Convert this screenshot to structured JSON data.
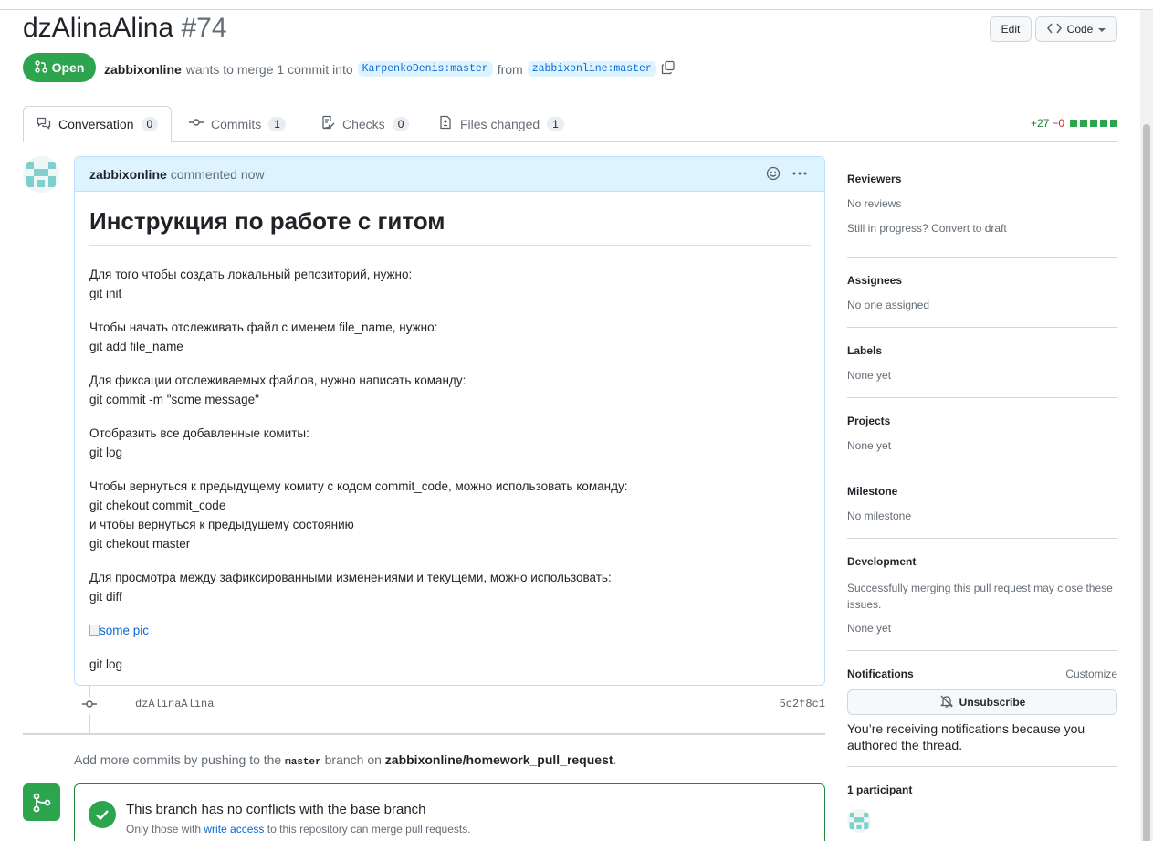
{
  "header": {
    "title": "dzAlinaAlina",
    "number": "#74",
    "edit_label": "Edit",
    "code_label": "Code"
  },
  "status": {
    "state_label": "Open",
    "author": "zabbixonline",
    "merge_text": "wants to merge 1 commit into",
    "base_branch": "KarpenkoDenis:master",
    "from_text": "from",
    "head_branch": "zabbixonline:master"
  },
  "tabs": [
    {
      "label": "Conversation",
      "count": "0",
      "icon": "comment-discussion-icon"
    },
    {
      "label": "Commits",
      "count": "1",
      "icon": "git-commit-icon"
    },
    {
      "label": "Checks",
      "count": "0",
      "icon": "checklist-icon"
    },
    {
      "label": "Files changed",
      "count": "1",
      "icon": "file-diff-icon"
    }
  ],
  "diffstat": {
    "additions": "+27",
    "deletions": "−0"
  },
  "comment": {
    "author": "zabbixonline",
    "action": "commented now",
    "heading": "Инструкция по работе с гитом",
    "paragraphs": [
      [
        "Для того чтобы создать локальный репозиторий, нужно:",
        "git init"
      ],
      [
        "Чтобы начать отслеживать файл с именем file_name, нужно:",
        "git add file_name"
      ],
      [
        "Для фиксации отслеживаемых файлов, нужно написать команду:",
        "git commit -m \"some message\""
      ],
      [
        "Отобразить все добавленные комиты:",
        "git log"
      ],
      [
        "Чтобы вернуться к предыдущему комиту с кодом commit_code, можно использовать команду:",
        "git chekout commit_code",
        "и чтобы вернуться к предыдущему состоянию",
        "git chekout master"
      ],
      [
        "Для просмотра между зафиксированными изменениями и текущеми, можно использовать:",
        "git diff"
      ]
    ],
    "image_alt": "some pic",
    "last_line": "git log"
  },
  "commit": {
    "message": "dzAlinaAlina",
    "sha": "5c2f8c1"
  },
  "add_more": {
    "prefix": "Add more commits by pushing to the",
    "branch": "master",
    "middle": "branch on",
    "repo": "zabbixonline/homework_pull_request",
    "suffix": "."
  },
  "merge": {
    "title": "This branch has no conflicts with the base branch",
    "sub_prefix": "Only those with",
    "sub_link": "write access",
    "sub_suffix": "to this repository can merge pull requests."
  },
  "sidebar": {
    "reviewers": {
      "heading": "Reviewers",
      "value": "No reviews",
      "extra_prefix": "Still in progress?",
      "extra_link": "Convert to draft"
    },
    "assignees": {
      "heading": "Assignees",
      "value": "No one assigned"
    },
    "labels": {
      "heading": "Labels",
      "value": "None yet"
    },
    "projects": {
      "heading": "Projects",
      "value": "None yet"
    },
    "milestone": {
      "heading": "Milestone",
      "value": "No milestone"
    },
    "development": {
      "heading": "Development",
      "description": "Successfully merging this pull request may close these issues.",
      "value": "None yet"
    },
    "notifications": {
      "heading": "Notifications",
      "customize": "Customize",
      "button": "Unsubscribe",
      "note": "You’re receiving notifications because you authored the thread."
    },
    "participants": {
      "heading": "1 participant"
    }
  },
  "colors": {
    "open": "#2da44e",
    "link": "#0969da",
    "header_bg": "#ddf4ff"
  }
}
